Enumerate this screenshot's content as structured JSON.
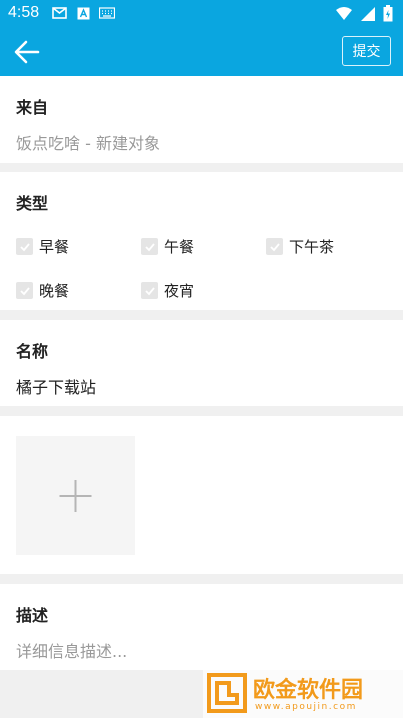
{
  "status": {
    "time": "4:58"
  },
  "toolbar": {
    "submit_label": "提交"
  },
  "from": {
    "label": "来自",
    "value": "饭点吃啥 - 新建对象"
  },
  "type": {
    "label": "类型",
    "options": [
      {
        "label": "早餐",
        "checked": false
      },
      {
        "label": "午餐",
        "checked": false
      },
      {
        "label": "下午茶",
        "checked": false
      },
      {
        "label": "晚餐",
        "checked": false
      },
      {
        "label": "夜宵",
        "checked": false
      }
    ]
  },
  "name": {
    "label": "名称",
    "value": "橘子下载站"
  },
  "description": {
    "label": "描述",
    "placeholder": "详细信息描述..."
  },
  "watermark": {
    "text": "欧金软件园",
    "url": "www.apoujin.com"
  },
  "colors": {
    "primary": "#0aa6e0",
    "annotation_arrow": "#e8452c",
    "watermark_orange": "#f29a1b"
  }
}
